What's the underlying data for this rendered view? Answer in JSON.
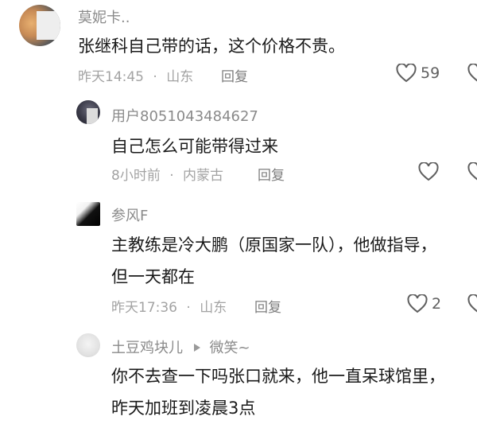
{
  "comments": [
    {
      "username": "莫妮卡..",
      "content": [
        "张继科自己带的话，这个价格不贵。"
      ],
      "time": "昨天14:45",
      "location": "山东",
      "reply": "回复",
      "likes": "59"
    },
    {
      "username": "用户8051043484627",
      "content": [
        "自己怎么可能带得过来"
      ],
      "time": "8小时前",
      "location": "内蒙古",
      "reply": "回复",
      "likes": ""
    },
    {
      "username": "参风F",
      "content": [
        "主教练是冷大鹏（原国家一队），他做指导，",
        "但一天都在"
      ],
      "time": "昨天17:36",
      "location": "山东",
      "reply": "回复",
      "likes": "2"
    },
    {
      "username": "土豆鸡块儿",
      "reply_to": "微笑~",
      "content": [
        "你不去查一下吗张口就来，他一直呆球馆里，",
        "昨天加班到凌晨3点"
      ]
    }
  ],
  "separator": "·",
  "icons": {
    "like": "heart-outline-icon",
    "reply_to": "triangle-right-icon"
  },
  "colors": {
    "username": "#8a8a8a",
    "content": "#1a1a1a",
    "meta": "#a3a3a3",
    "icon": "#5f5f5f"
  }
}
